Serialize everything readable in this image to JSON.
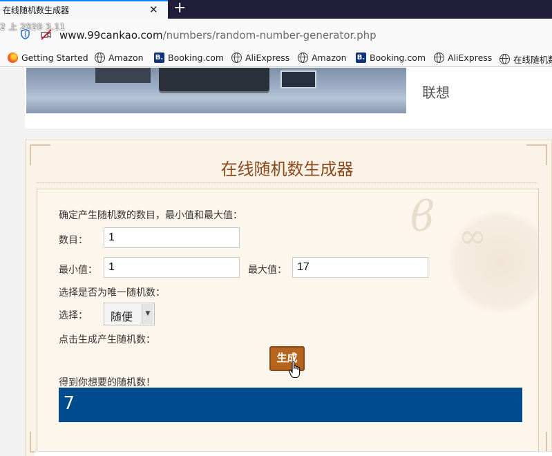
{
  "browser": {
    "tab_title": "在线随机数生成器",
    "tab_close": "✕",
    "new_tab": "+",
    "timestamp": "2 上 2020 3.11",
    "url_host": "www.99cankao.com",
    "url_path": "/numbers/random-number-generator.php",
    "bookmarks": [
      {
        "label": "Getting Started",
        "icon": "firefox-icon"
      },
      {
        "label": "Amazon",
        "icon": "globe-icon"
      },
      {
        "label": "Booking.com",
        "icon": "booking-icon"
      },
      {
        "label": "AliExpress",
        "icon": "globe-icon"
      },
      {
        "label": "Amazon",
        "icon": "globe-icon"
      },
      {
        "label": "Booking.com",
        "icon": "booking-icon"
      },
      {
        "label": "AliExpress",
        "icon": "globe-icon"
      },
      {
        "label": "在线随机数",
        "icon": "globe-icon"
      }
    ],
    "booking_letter": "B."
  },
  "product": {
    "name": "联想"
  },
  "generator": {
    "title": "在线随机数生成器",
    "instruction": "确定产生随机数的数目，最小值和最大值：",
    "count_label": "数目：",
    "count_value": "1",
    "min_label": "最小值：",
    "min_value": "1",
    "max_label": "最大值：",
    "max_value": "17",
    "unique_prompt": "选择是否为唯一随机数：",
    "select_label": "选择：",
    "select_value": "随便",
    "click_prompt": "点击生成产生随机数：",
    "generate_label": "生成",
    "result_label": "得到你想要的随机数！",
    "result_value": "7"
  },
  "colors": {
    "accent_title": "#8a4a1c",
    "button": "#b5651d",
    "result_bg": "#004b8d",
    "panel_bg": "#fbf3e7"
  }
}
